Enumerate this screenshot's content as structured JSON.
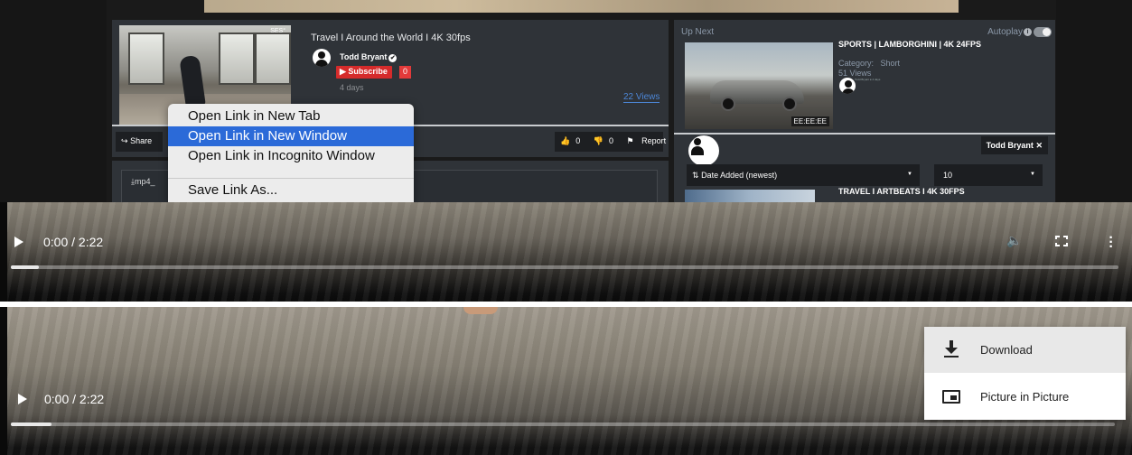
{
  "video": {
    "title": "Travel I Around the World I 4K 30fps",
    "thumb_tag": "SES°",
    "channel": "Todd Bryant",
    "verified_glyph": "✔",
    "subscribe_label": "Subscribe",
    "subscribe_count": "0",
    "age": "4 days",
    "views": "22 Views",
    "share_label": "Share",
    "likes": "0",
    "dislikes": "0",
    "report_label": "Report",
    "download_tab": "mp4_"
  },
  "context_menu": {
    "items": [
      "Open Link in New Tab",
      "Open Link in New Window",
      "Open Link in Incognito Window",
      "Save Link As..."
    ],
    "highlighted_index": 1
  },
  "sidebar": {
    "up_next_label": "Up Next",
    "autoplay_label": "Autoplay",
    "info_glyph": "i",
    "next_video": {
      "title": "SPORTS | LAMBORGHINI | 4K 24FPS",
      "category_label": "Category:",
      "category_value": "Short",
      "views": "51 Views",
      "tiny_meta": "Todd Bryant ● 4 days",
      "timestamp": "EE:EE:EE"
    },
    "user_chip": "Todd Bryant",
    "sort_value": "Date Added (newest)",
    "count_value": "10",
    "second_video_title": "TRAVEL I ARTBEATS I 4K 30FPS"
  },
  "player_top": {
    "time": "0:00 / 2:22",
    "progress": 0.025
  },
  "player_bottom": {
    "time": "0:00 / 2:22",
    "progress": 0.037,
    "menu": {
      "download_label": "Download",
      "pip_label": "Picture in Picture",
      "highlighted": "download"
    }
  },
  "colors": {
    "subscribe": "#d52b2b",
    "link": "#4c86d6",
    "menu_highlight": "#2b6ad8",
    "card_bg": "#2f3338"
  },
  "icons": [
    "share-icon",
    "thumbs-up-icon",
    "thumbs-down-icon",
    "flag-icon",
    "download-icon",
    "sort-icon",
    "play-icon",
    "volume-icon",
    "fullscreen-icon",
    "more-vert-icon",
    "picture-in-picture-icon"
  ]
}
